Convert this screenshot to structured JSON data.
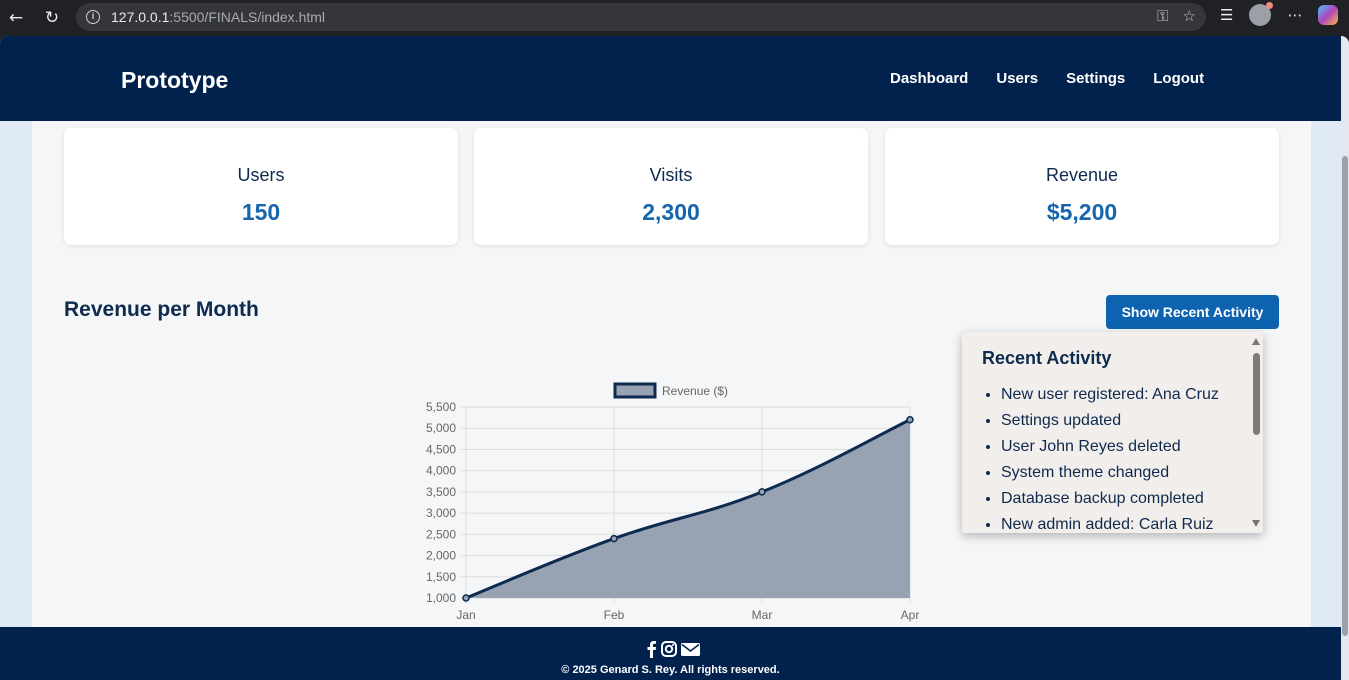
{
  "browser": {
    "url_host": "127.0.0.1",
    "url_rest": ":5500/FINALS/index.html"
  },
  "header": {
    "logo": "Prototype",
    "nav": [
      "Dashboard",
      "Users",
      "Settings",
      "Logout"
    ]
  },
  "stats": [
    {
      "label": "Users",
      "value": "150"
    },
    {
      "label": "Visits",
      "value": "2,300"
    },
    {
      "label": "Revenue",
      "value": "$5,200"
    }
  ],
  "section": {
    "title": "Revenue per Month",
    "button": "Show Recent Activity"
  },
  "activity": {
    "title": "Recent Activity",
    "items": [
      "New user registered: Ana Cruz",
      "Settings updated",
      "User John Reyes deleted",
      "System theme changed",
      "Database backup completed",
      "New admin added: Carla Ruiz"
    ]
  },
  "chart_data": {
    "type": "area",
    "categories": [
      "Jan",
      "Feb",
      "Mar",
      "Apr"
    ],
    "series": [
      {
        "name": "Revenue ($)",
        "values": [
          1000,
          2400,
          3500,
          5200
        ]
      }
    ],
    "ylim": [
      1000,
      5500
    ],
    "yticks": [
      "1,000",
      "1,500",
      "2,000",
      "2,500",
      "3,000",
      "3,500",
      "4,000",
      "4,500",
      "5,000",
      "5,500"
    ],
    "grid": true,
    "legend": "top",
    "line_color": "#0d2a4f",
    "fill_color": "#97a3b2"
  },
  "footer": {
    "icons": [
      "facebook-icon",
      "instagram-icon",
      "envelope-icon"
    ],
    "copyright": "© 2025 Genard S. Rey. All rights reserved."
  }
}
